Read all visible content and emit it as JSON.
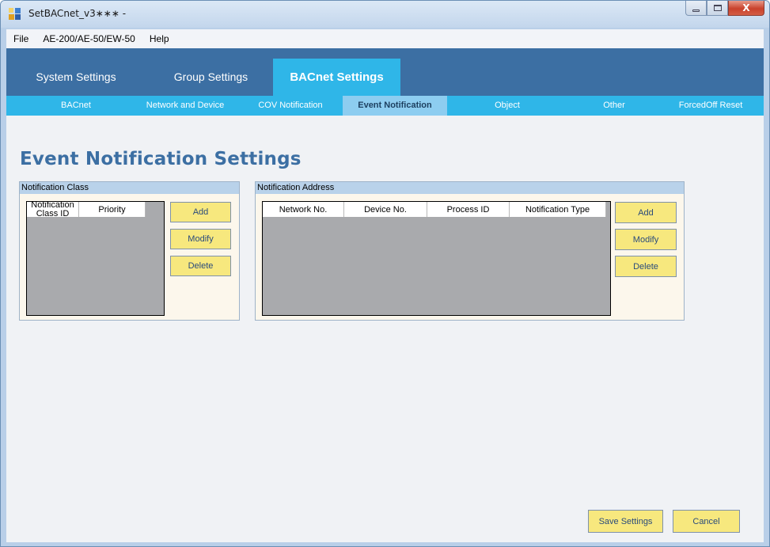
{
  "window": {
    "title": "SetBACnet_v3∗∗∗ -",
    "minimize_icon": "minimize-icon",
    "maximize_icon": "maximize-icon",
    "close_label": "X"
  },
  "menu": {
    "items": [
      {
        "label": "File"
      },
      {
        "label": "AE-200/AE-50/EW-50"
      },
      {
        "label": "Help"
      }
    ]
  },
  "main_tabs": [
    {
      "label": "System Settings"
    },
    {
      "label": "Group Settings"
    },
    {
      "label": "BACnet Settings",
      "active": true
    }
  ],
  "sub_tabs": [
    {
      "label": "BACnet"
    },
    {
      "label": "Network and Device"
    },
    {
      "label": "COV Notification"
    },
    {
      "label": "Event Notification",
      "active": true
    },
    {
      "label": "Object"
    },
    {
      "label": "Other"
    },
    {
      "label": "ForcedOff Reset"
    }
  ],
  "page": {
    "title": "Event Notification Settings"
  },
  "notification_class": {
    "title": "Notification Class",
    "columns": [
      "Notification Class ID",
      "Priority"
    ],
    "col_line1": "Notification",
    "col_line2": "Class ID",
    "rows": [],
    "buttons": {
      "add": "Add",
      "modify": "Modify",
      "delete": "Delete"
    }
  },
  "notification_address": {
    "title": "Notification Address",
    "columns": [
      "Network No.",
      "Device No.",
      "Process ID",
      "Notification Type"
    ],
    "rows": [],
    "buttons": {
      "add": "Add",
      "modify": "Modify",
      "delete": "Delete"
    }
  },
  "footer": {
    "save_label": "Save Settings",
    "cancel_label": "Cancel"
  },
  "colors": {
    "tab_bar": "#3c6fa3",
    "active_tab": "#2fb6e8",
    "button_fill": "#f7e87e",
    "groupbox_header": "#b9d2ea",
    "list_background": "#a9aaad"
  }
}
